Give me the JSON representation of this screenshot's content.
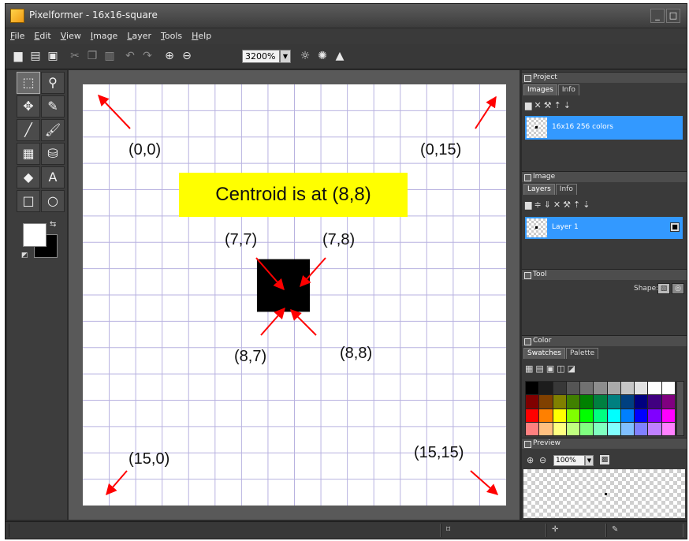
{
  "window": {
    "title": "Pixelformer - 16x16-square",
    "minimize": "_",
    "maximize": "□",
    "close": "×"
  },
  "menu": [
    {
      "accel": "F",
      "rest": "ile"
    },
    {
      "accel": "E",
      "rest": "dit"
    },
    {
      "accel": "V",
      "rest": "iew"
    },
    {
      "accel": "I",
      "rest": "mage"
    },
    {
      "accel": "L",
      "rest": "ayer"
    },
    {
      "accel": "T",
      "rest": "ools"
    },
    {
      "accel": "H",
      "rest": "elp"
    }
  ],
  "toolbar": {
    "zoom_value": "3200%",
    "icons": [
      "new-icon",
      "open-icon",
      "save-icon",
      "cut-icon",
      "copy-icon",
      "paste-icon",
      "undo-icon",
      "redo-icon",
      "zoom-in-icon",
      "zoom-out-icon",
      "brightness-icon",
      "contrast-icon",
      "hue-icon"
    ]
  },
  "tools": [
    "rect-select-icon",
    "magic-wand-icon",
    "move-icon",
    "pencil-icon",
    "line-icon",
    "brush-icon",
    "gradient-icon",
    "fill-icon",
    "eraser-icon",
    "text-icon",
    "rectangle-icon",
    "ellipse-icon"
  ],
  "canvas": {
    "grid_size": 16,
    "filled_cells": [
      [
        7,
        7
      ],
      [
        7,
        8
      ],
      [
        8,
        7
      ],
      [
        8,
        8
      ]
    ],
    "centroid_label": "Centroid is at (8,8)",
    "annotations": {
      "tl": "(0,0)",
      "tr": "(0,15)",
      "bl": "(15,0)",
      "br": "(15,15)",
      "c77": "(7,7)",
      "c78": "(7,8)",
      "c87": "(8,7)",
      "c88": "(8,8)"
    },
    "arrow_color": "#ff0000",
    "grid_color": "#b8b2e0"
  },
  "project_panel": {
    "title": "Project",
    "tabs": [
      "Images",
      "Info"
    ],
    "item_label": "16x16 256 colors"
  },
  "image_panel": {
    "title": "Image",
    "tabs": [
      "Layers",
      "Info"
    ],
    "layer_label": "Layer 1"
  },
  "tool_panel": {
    "title": "Tool",
    "shape_label": "Shape:"
  },
  "color_panel": {
    "title": "Color",
    "tabs": [
      "Swatches",
      "Palette"
    ],
    "palette": [
      "#000000",
      "#1c1c1c",
      "#383838",
      "#555555",
      "#717171",
      "#8d8d8d",
      "#aaaaaa",
      "#c6c6c6",
      "#e2e2e2",
      "#ffffff",
      "#ffffff",
      "#800000",
      "#804000",
      "#808000",
      "#408000",
      "#008000",
      "#008040",
      "#008080",
      "#004080",
      "#000080",
      "#400080",
      "#800080",
      "#ff0000",
      "#ff8000",
      "#ffff00",
      "#80ff00",
      "#00ff00",
      "#00ff80",
      "#00ffff",
      "#0080ff",
      "#0000ff",
      "#8000ff",
      "#ff00ff",
      "#ff8080",
      "#ffc080",
      "#ffff80",
      "#c0ff80",
      "#80ff80",
      "#80ffc0",
      "#80ffff",
      "#80c0ff",
      "#8080ff",
      "#c080ff",
      "#ff80ff"
    ]
  },
  "preview_panel": {
    "title": "Preview",
    "zoom_value": "100%"
  }
}
